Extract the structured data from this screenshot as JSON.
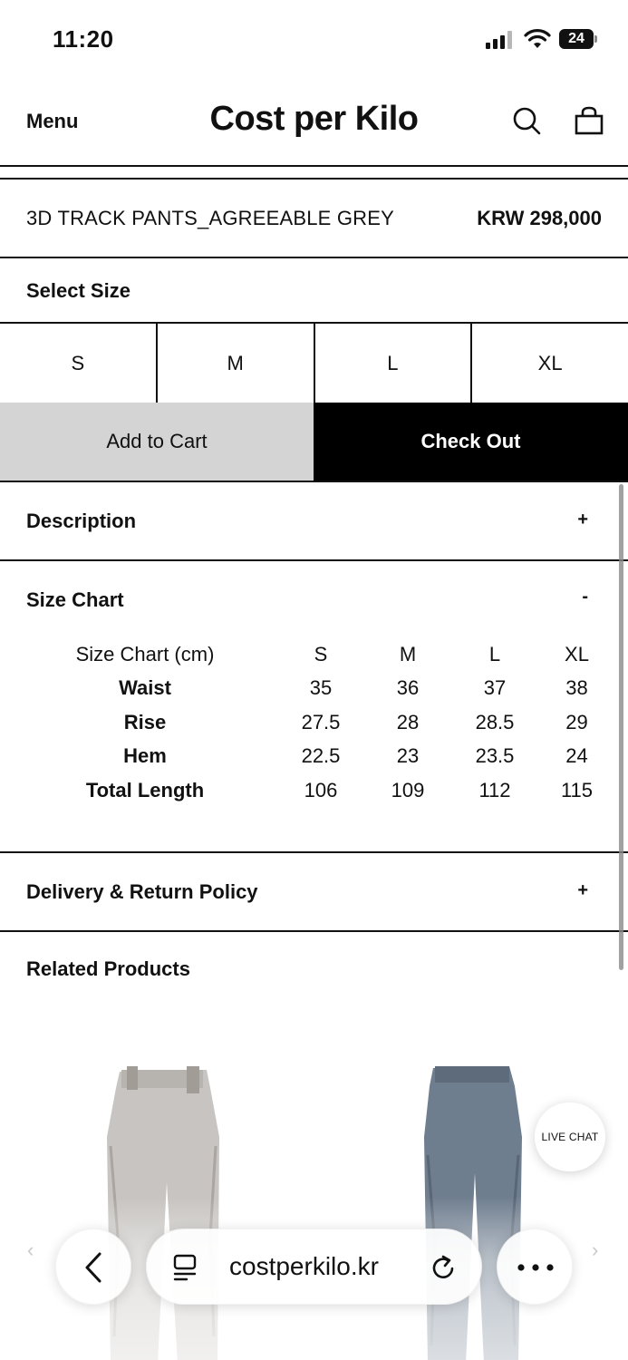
{
  "status_bar": {
    "time": "11:20",
    "battery": "24"
  },
  "header": {
    "menu_label": "Menu",
    "title": "Cost per Kilo"
  },
  "product": {
    "name": "3D TRACK PANTS_AGREEABLE GREY",
    "price": "KRW 298,000"
  },
  "size_select": {
    "label": "Select Size",
    "options": [
      "S",
      "M",
      "L",
      "XL"
    ]
  },
  "actions": {
    "add_to_cart": "Add to Cart",
    "check_out": "Check Out"
  },
  "description": {
    "label": "Description",
    "toggle": "+"
  },
  "size_chart": {
    "label": "Size Chart",
    "toggle": "-",
    "header": [
      "Size Chart (cm)",
      "S",
      "M",
      "L",
      "XL"
    ],
    "rows": [
      [
        "Waist",
        "35",
        "36",
        "37",
        "38"
      ],
      [
        "Rise",
        "27.5",
        "28",
        "28.5",
        "29"
      ],
      [
        "Hem",
        "22.5",
        "23",
        "23.5",
        "24"
      ],
      [
        "Total Length",
        "106",
        "109",
        "112",
        "115"
      ]
    ]
  },
  "delivery": {
    "label": "Delivery & Return Policy",
    "toggle": "+"
  },
  "related": {
    "title": "Related Products"
  },
  "live_chat": {
    "label": "LIVE CHAT"
  },
  "browser": {
    "url": "costperkilo.kr",
    "prev_arrow": "‹",
    "next_arrow": "›"
  },
  "colors": {
    "accent": "#000000",
    "cart_button": "#d4d4d4",
    "product_1": "#c7c4c1",
    "product_2": "#6f7e8f"
  }
}
